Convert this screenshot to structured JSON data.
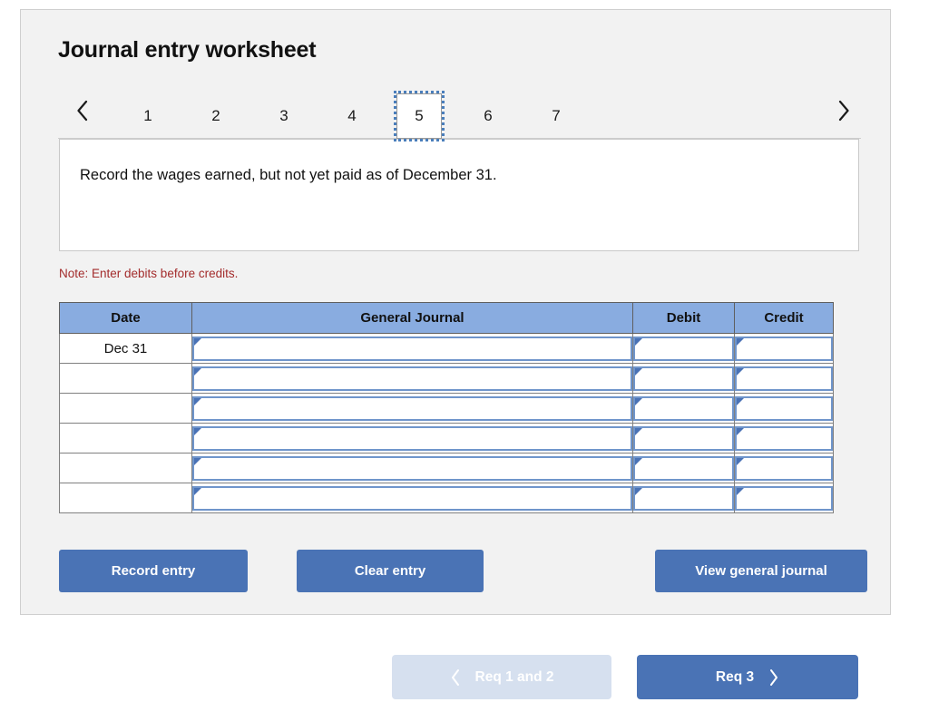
{
  "worksheet": {
    "title": "Journal entry worksheet",
    "prev_arrow_icon": "chevron-left-icon",
    "next_arrow_icon": "chevron-right-icon",
    "tabs": [
      {
        "label": "1",
        "active": false
      },
      {
        "label": "2",
        "active": false
      },
      {
        "label": "3",
        "active": false
      },
      {
        "label": "4",
        "active": false
      },
      {
        "label": "5",
        "active": true
      },
      {
        "label": "6",
        "active": false
      },
      {
        "label": "7",
        "active": false
      }
    ],
    "instruction": "Record the wages earned, but not yet paid as of December 31.",
    "note": "Note: Enter debits before credits."
  },
  "table": {
    "headers": [
      "Date",
      "General Journal",
      "Debit",
      "Credit"
    ],
    "rows": [
      {
        "date": "Dec 31",
        "general_journal": "",
        "debit": "",
        "credit": ""
      },
      {
        "date": "",
        "general_journal": "",
        "debit": "",
        "credit": ""
      },
      {
        "date": "",
        "general_journal": "",
        "debit": "",
        "credit": ""
      },
      {
        "date": "",
        "general_journal": "",
        "debit": "",
        "credit": ""
      },
      {
        "date": "",
        "general_journal": "",
        "debit": "",
        "credit": ""
      },
      {
        "date": "",
        "general_journal": "",
        "debit": "",
        "credit": ""
      }
    ]
  },
  "actions": {
    "record_entry": "Record entry",
    "clear_entry": "Clear entry",
    "view_general_journal": "View general journal"
  },
  "nav": {
    "prev_label": "Req 1 and 2",
    "prev_icon": "chevron-left-icon",
    "next_label": "Req 3",
    "next_icon": "chevron-right-icon"
  },
  "colors": {
    "panel_background": "#f2f2f2",
    "table_header_blue": "#89ace0",
    "button_blue": "#4a73b5",
    "disabled_button_blue": "#d6e0ef",
    "note_red": "#a32c2c",
    "cell_border_blue": "#6f95cb",
    "focus_outline_blue": "#4a7ebb"
  }
}
